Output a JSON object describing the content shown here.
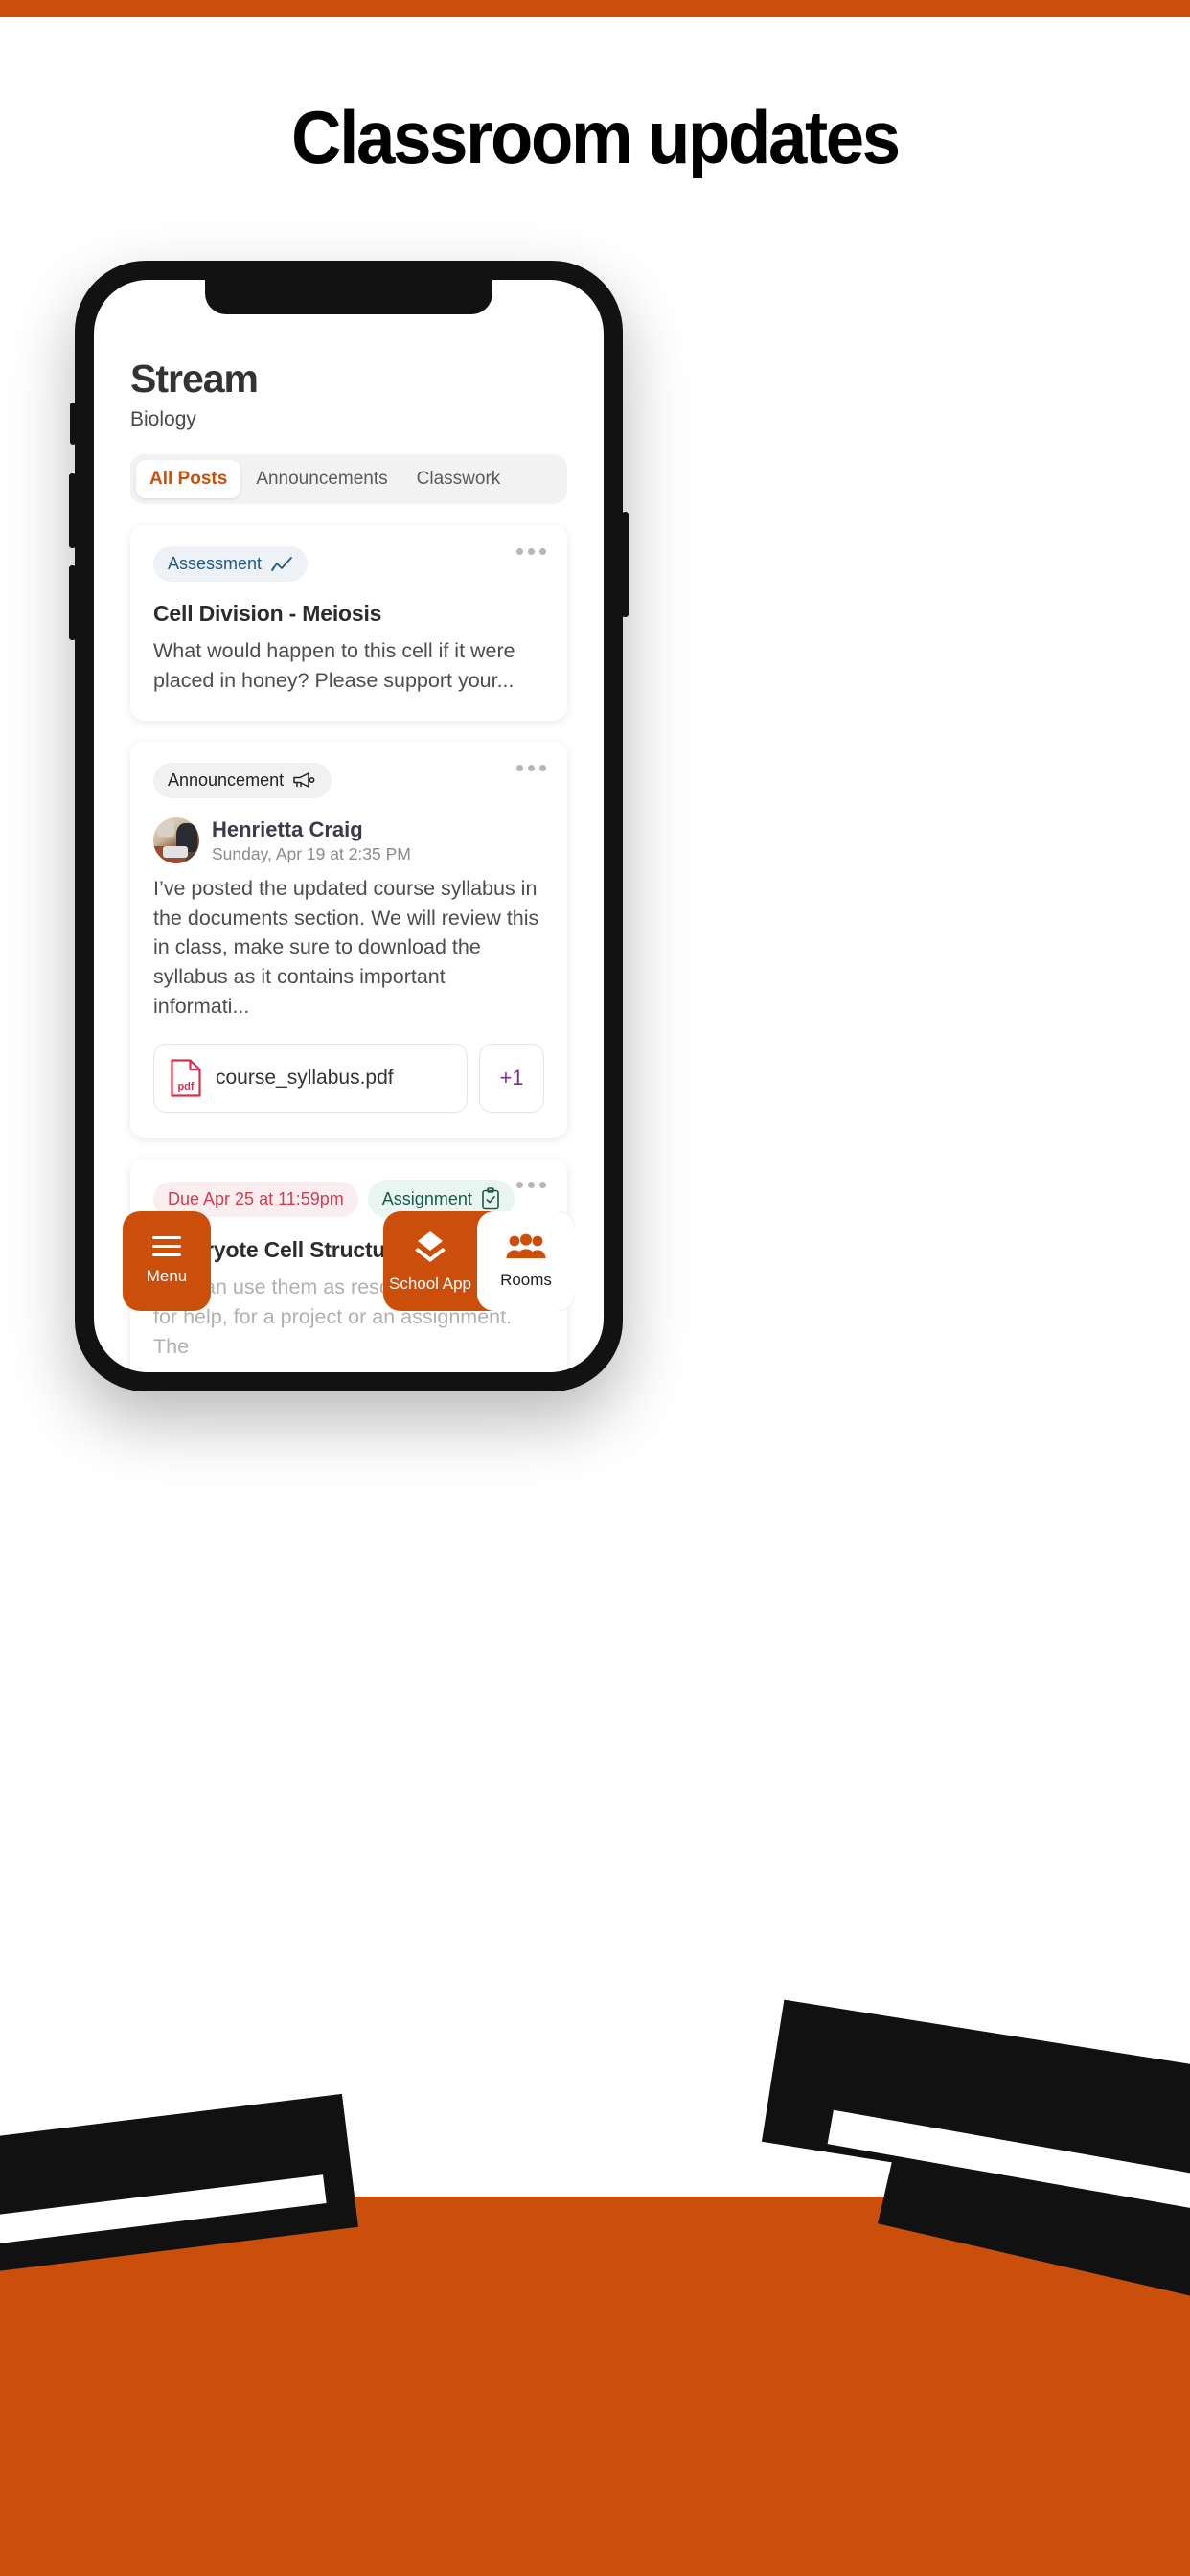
{
  "poster": {
    "headline": "Classroom updates",
    "accent_color": "#CC4E0B"
  },
  "app": {
    "header": {
      "title": "Stream",
      "subtitle": "Biology"
    },
    "tabs": [
      {
        "label": "All Posts",
        "active": true
      },
      {
        "label": "Announcements",
        "active": false
      },
      {
        "label": "Classwork",
        "active": false
      }
    ],
    "posts": [
      {
        "badge": "Assessment",
        "badge_icon": "trending-line-chart-icon",
        "title": "Cell Division - Meiosis",
        "body": "What would happen to this cell if it were placed in honey? Please support your...",
        "overflow_menu": "more-options-icon"
      },
      {
        "badge": "Announcement",
        "badge_icon": "megaphone-icon",
        "author": "Henrietta Craig",
        "timestamp": "Sunday, Apr 19 at 2:35 PM",
        "body": "I’ve posted the updated course syllabus in the documents section. We will review this in class, make sure to download the syllabus as it contains important informati...",
        "attachment": {
          "file_name": "course_syllabus.pdf",
          "file_type": "pdf",
          "more_count": "+1"
        },
        "overflow_menu": "more-options-icon"
      },
      {
        "due_badge": "Due Apr 25 at 11:59pm",
        "badge": "Assignment",
        "badge_icon": "clipboard-check-icon",
        "title": "Eukaryote Cell Structure",
        "body": "You can use them as resources to go to for help, for a project or an assignment. The",
        "overflow_menu": "more-options-icon"
      }
    ],
    "bottom_bar": {
      "menu": {
        "label": "Menu",
        "icon": "hamburger-icon"
      },
      "school_app": {
        "label": "School App",
        "icon": "layers-icon"
      },
      "rooms": {
        "label": "Rooms",
        "icon": "people-group-icon"
      }
    }
  }
}
